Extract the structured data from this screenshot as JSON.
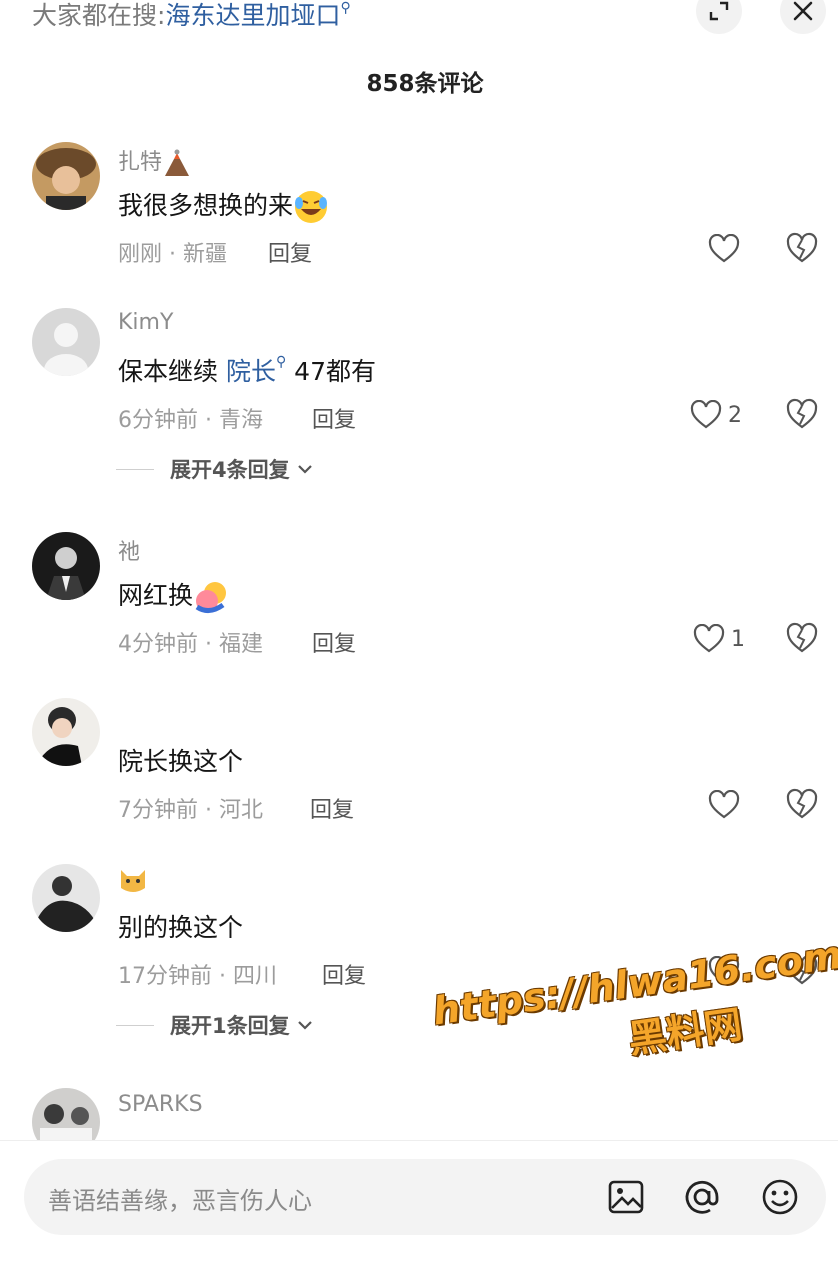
{
  "header": {
    "search_prefix": "大家都在搜:",
    "search_keyword": "海东达里加垭口",
    "comment_count_title": "858条评论"
  },
  "comments": [
    {
      "username": "扎特",
      "username_emoji": "volcano-emoji",
      "text": "我很多想换的来",
      "text_emoji": "rofl-emoji",
      "time_location": "刚刚 · 新疆",
      "reply_label": "回复",
      "likes": ""
    },
    {
      "username": "KimY",
      "text_prefix": "保本继续 ",
      "text_link": "院长",
      "text_suffix": " 47都有",
      "time_location": "6分钟前 · 青海",
      "reply_label": "回复",
      "likes": "2",
      "expand_label": "展开4条回复"
    },
    {
      "username": "祂",
      "text": "网红换",
      "text_emoji": "hug-emoji",
      "time_location": "4分钟前 · 福建",
      "reply_label": "回复",
      "likes": "1"
    },
    {
      "username": "",
      "text": "院长换这个",
      "time_location": "7分钟前 · 河北",
      "reply_label": "回复",
      "likes": ""
    },
    {
      "username": "",
      "username_emoji": "cat-emoji",
      "text": "别的换这个",
      "time_location": "17分钟前 · 四川",
      "reply_label": "回复",
      "likes": "",
      "expand_label": "展开1条回复"
    },
    {
      "username": "SPARKS"
    }
  ],
  "input": {
    "placeholder": "善语结善缘，恶言伤人心"
  },
  "watermark": {
    "url": "https://hlwa16.com",
    "name": "黑料网"
  },
  "colors": {
    "link": "#2f5fa0",
    "meta": "#9c9c9c",
    "watermark": "#f4a52a"
  }
}
